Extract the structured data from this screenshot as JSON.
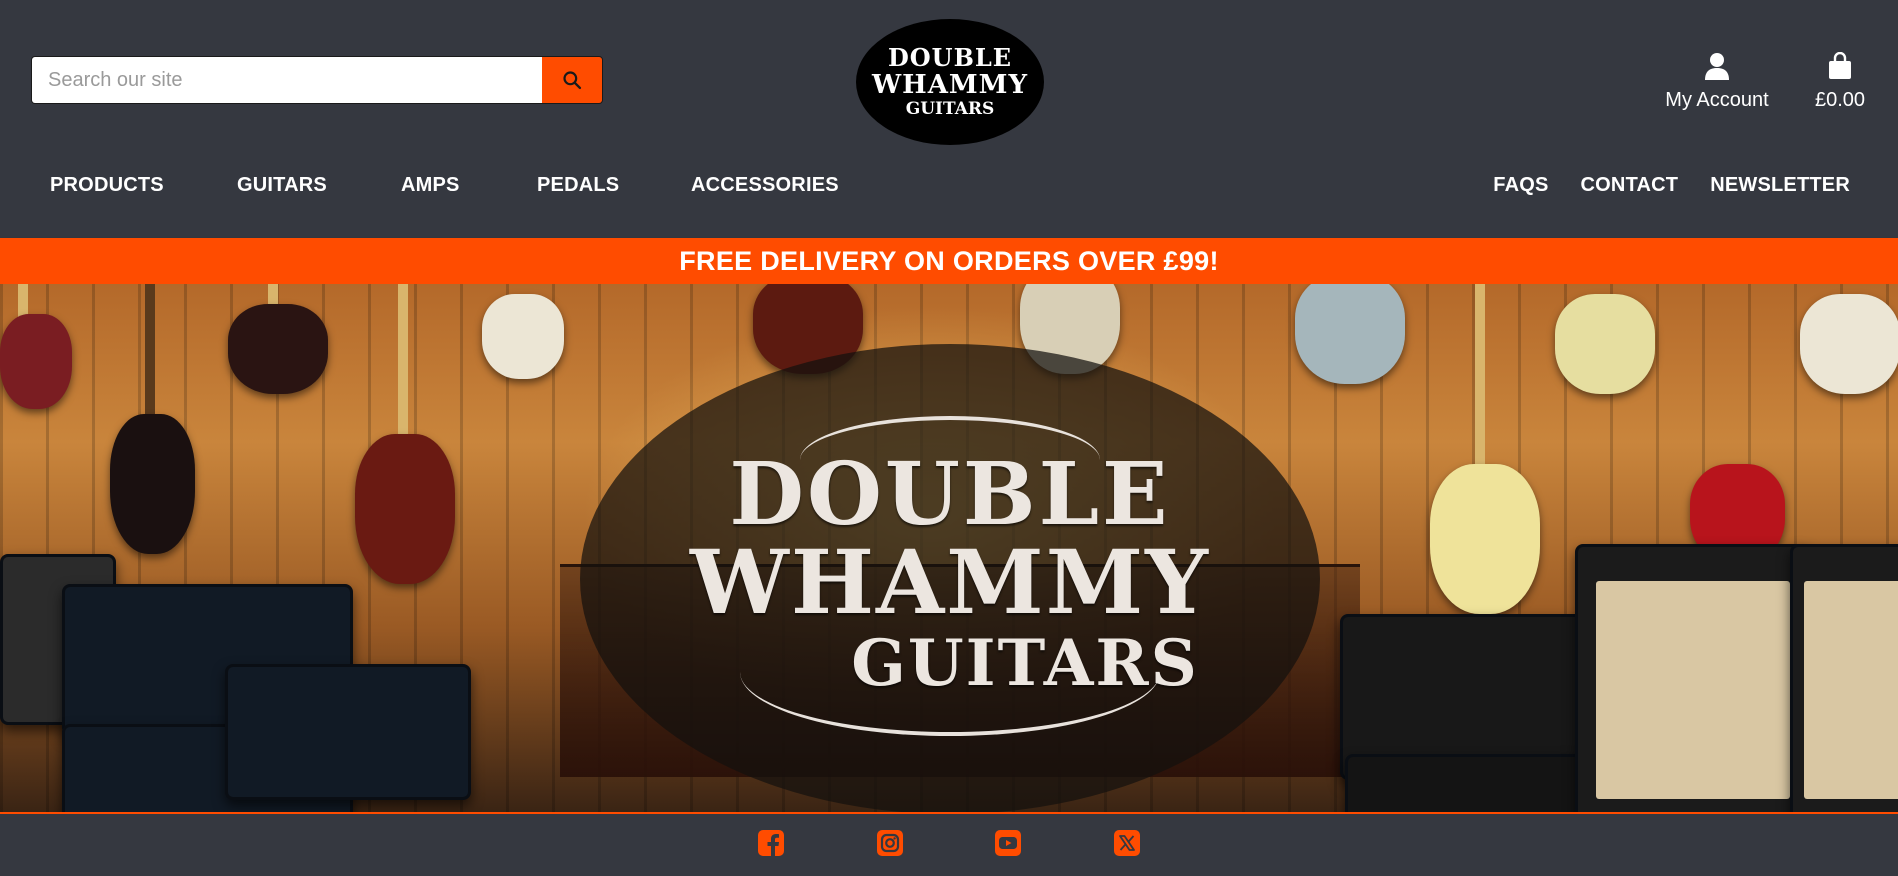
{
  "search": {
    "placeholder": "Search our site"
  },
  "logo": {
    "line1": "DOUBLE",
    "line2": "WHAMMY",
    "line3": "GUITARS"
  },
  "account": {
    "label": "My Account"
  },
  "cart": {
    "total": "£0.00"
  },
  "nav_left": [
    "PRODUCTS",
    "GUITARS",
    "AMPS",
    "PEDALS",
    "ACCESSORIES"
  ],
  "nav_right": [
    "FAQS",
    "CONTACT",
    "NEWSLETTER"
  ],
  "banner": {
    "text": "FREE DELIVERY ON ORDERS OVER £99!"
  },
  "hero": {
    "line1": "DOUBLE",
    "line2": "WHAMMY",
    "line3": "GUITARS"
  },
  "social": [
    "facebook-icon",
    "instagram-icon",
    "youtube-icon",
    "x-icon"
  ],
  "colors": {
    "accent": "#ff4c00",
    "header_bg": "#353840"
  }
}
